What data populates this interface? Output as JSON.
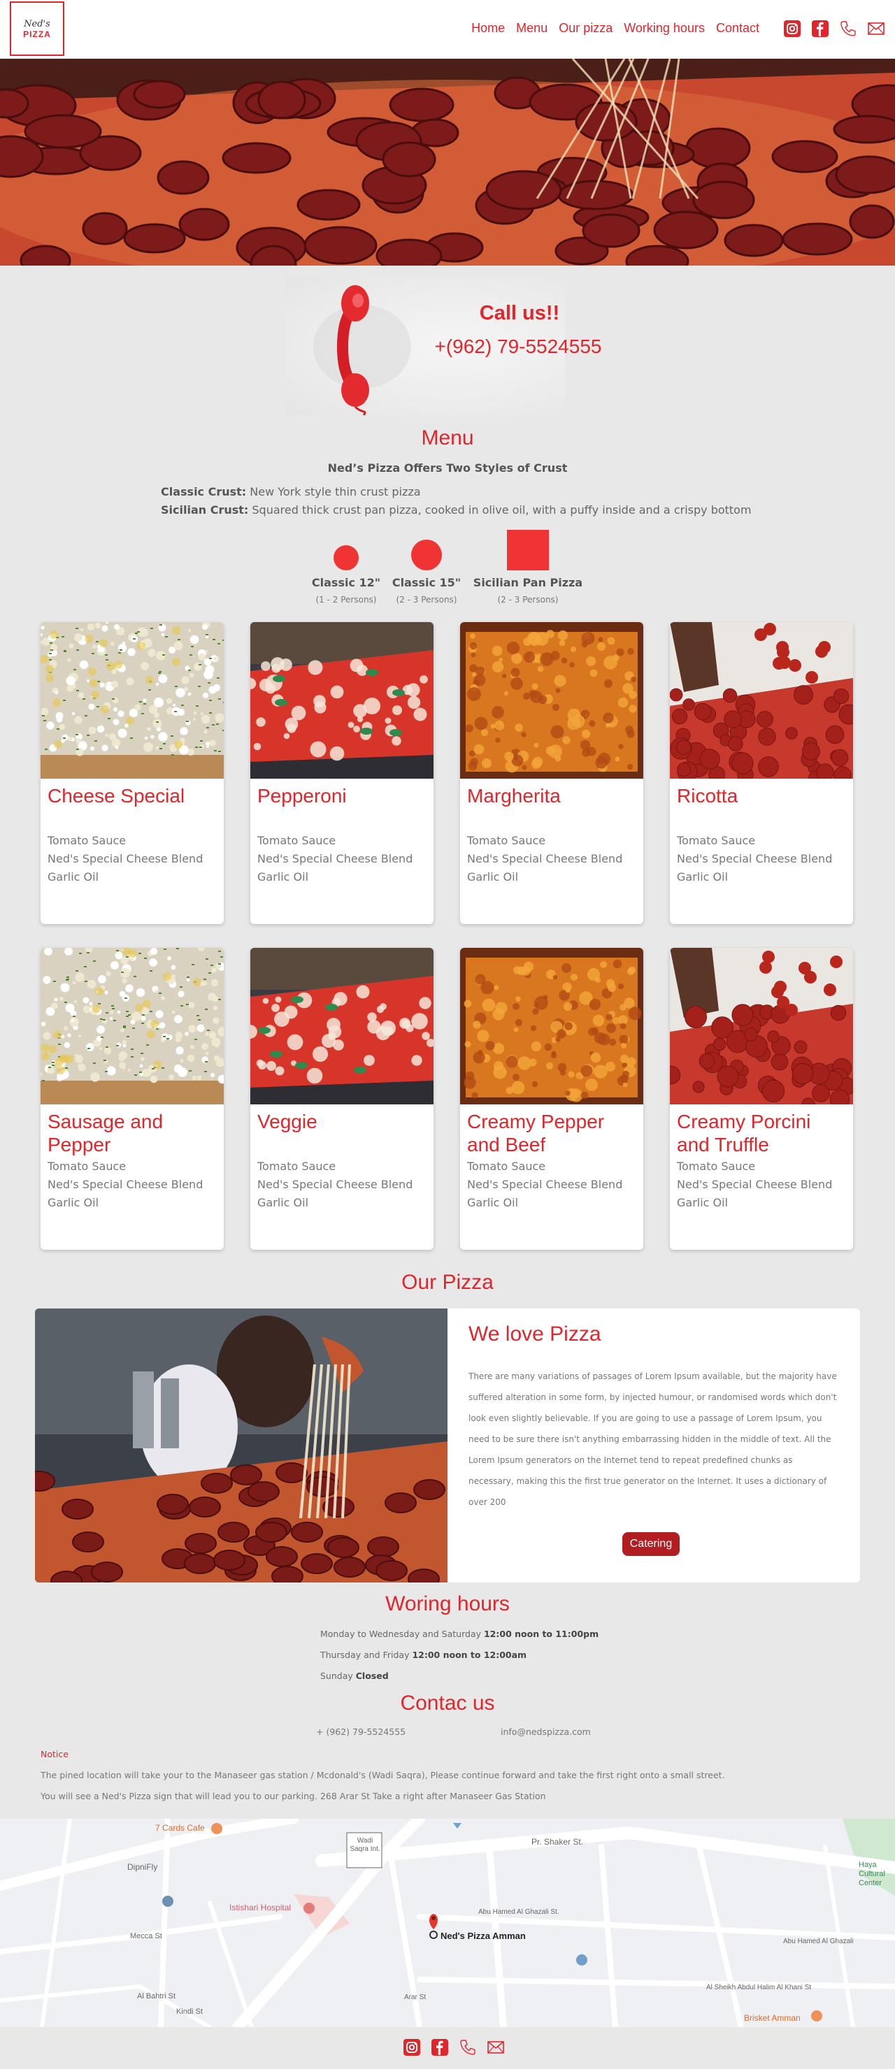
{
  "brand": {
    "logo_line1": "Ned's",
    "logo_line2": "PIZZA"
  },
  "nav": {
    "items": [
      "Home",
      "Menu",
      "Our pizza",
      "Working hours",
      "Contact"
    ]
  },
  "social_icons": [
    "instagram-icon",
    "facebook-icon",
    "phone-icon",
    "mail-icon"
  ],
  "call": {
    "title": "Call us!!",
    "phone": "+(962) 79-5524555"
  },
  "menu": {
    "title": "Menu",
    "subtitle": "Ned’s Pizza Offers Two Styles of Crust",
    "crusts": [
      {
        "name": "Classic Crust:",
        "desc": " New York style thin crust pizza"
      },
      {
        "name": "Sicilian Crust:",
        "desc": " Squared thick crust pan pizza, cooked in olive oil, with a puffy inside and a crispy bottom"
      }
    ],
    "sizes": [
      {
        "name": "Classic 12\"",
        "persons": "(1 - 2 Persons)"
      },
      {
        "name": "Classic 15\"",
        "persons": "(2 - 3 Persons)"
      },
      {
        "name": "Sicilian Pan Pizza",
        "persons": "(2 - 3 Persons)"
      }
    ],
    "pizzas": [
      {
        "name": "Cheese Special",
        "ingredients": [
          "Tomato Sauce",
          "Ned's Special Cheese Blend",
          "Garlic Oil"
        ]
      },
      {
        "name": "Pepperoni",
        "ingredients": [
          "Tomato Sauce",
          "Ned's Special Cheese Blend",
          "Garlic Oil"
        ]
      },
      {
        "name": "Margherita",
        "ingredients": [
          "Tomato Sauce",
          "Ned's Special Cheese Blend",
          "Garlic Oil"
        ]
      },
      {
        "name": "Ricotta",
        "ingredients": [
          "Tomato Sauce",
          "Ned's Special Cheese Blend",
          "Garlic Oil"
        ]
      },
      {
        "name": "Sausage and Pepper",
        "ingredients": [
          "Tomato Sauce",
          "Ned's Special Cheese Blend",
          "Garlic Oil"
        ]
      },
      {
        "name": "Veggie",
        "ingredients": [
          "Tomato Sauce",
          "Ned's Special Cheese Blend",
          "Garlic Oil"
        ]
      },
      {
        "name": "Creamy Pepper and Beef",
        "ingredients": [
          "Tomato Sauce",
          "Ned's Special Cheese Blend",
          "Garlic Oil"
        ]
      },
      {
        "name": "Creamy Porcini and Truffle",
        "ingredients": [
          "Tomato Sauce",
          "Ned's Special Cheese Blend",
          "Garlic Oil"
        ]
      }
    ]
  },
  "our_pizza": {
    "title": "Our Pizza",
    "heading": "We love Pizza",
    "text": "There are many variations of passages of Lorem Ipsum available, but the majority have suffered alteration in some form, by injected humour, or randomised words which don't look even slightly believable. If you are going to use a passage of Lorem Ipsum, you need to be sure there isn't anything embarrassing hidden in the middle of text. All the Lorem Ipsum generators on the Internet tend to repeat predefined chunks as necessary, making this the first true generator on the Internet. It uses a dictionary of over 200",
    "button": "Catering"
  },
  "hours": {
    "title": "Woring hours",
    "lines": [
      {
        "days": "Monday to Wednesday and Saturday ",
        "time": "12:00 noon to 11:00pm"
      },
      {
        "days": "Thursday and Friday ",
        "time": "12:00 noon to 12:00am"
      },
      {
        "days": "Sunday ",
        "time": "Closed"
      }
    ]
  },
  "contact": {
    "title": "Contac us",
    "phone": "+ (962) 79-5524555",
    "email": "info@nedspizza.com",
    "notice_label": "Notice",
    "notice_lines": [
      "The pined location will take your to the Manaseer gas station / Mcdonald's (Wadi Saqra), Please continue forward and take the first right onto a small street.",
      "You will see a Ned's Pizza sign that will lead you to our parking. 268 Arar St Take a right after Manaseer Gas Station"
    ]
  },
  "map": {
    "pin_label": "Ned's Pizza Amman",
    "labels": [
      "7 Cards Cafe",
      "DipniFly",
      "Istishari Hospital",
      "Wadi Saqra Int.",
      "Pr. Shaker St.",
      "Abu Hamed Al Ghazali St.",
      "Arar St",
      "Mecca St",
      "Kindi St",
      "Al Bahtri St",
      "Brisket Amman",
      "Haya Cultural Center",
      "Al Sheikh Abdul Halim Al Khani St",
      "Abu Hamed Al Ghazali"
    ]
  },
  "colors": {
    "accent": "#e0262b",
    "button": "#b01e22",
    "background": "#e8e8e8"
  }
}
